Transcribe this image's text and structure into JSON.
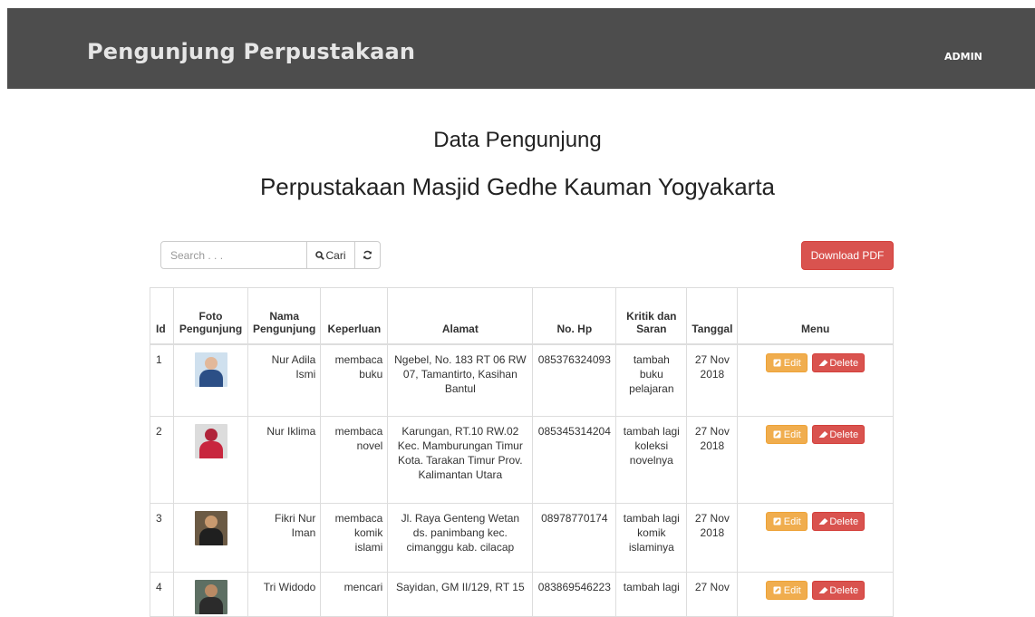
{
  "navbar": {
    "brand": "Pengunjung Perpustakaan",
    "user": "ADMIN"
  },
  "heading": {
    "title": "Data Pengunjung",
    "subtitle": "Perpustakaan Masjid Gedhe Kauman Yogyakarta"
  },
  "toolbar": {
    "search_placeholder": "Search . . .",
    "search_button": "Cari",
    "download_button": "Download PDF"
  },
  "table": {
    "headers": {
      "id": "Id",
      "foto": [
        "Foto",
        "Pengunjung"
      ],
      "nama": [
        "Nama",
        "Pengunjung"
      ],
      "keperluan": "Keperluan",
      "alamat": "Alamat",
      "nohp": "No. Hp",
      "kritik": [
        "Kritik dan",
        "Saran"
      ],
      "tanggal": "Tanggal",
      "menu": "Menu"
    },
    "rows": [
      {
        "id": "1",
        "nama": [
          "Nur Adila",
          "Ismi"
        ],
        "keperluan": [
          "membaca",
          "buku"
        ],
        "alamat": [
          "Ngebel, No. 183 RT 06 RW",
          "07, Tamantirto, Kasihan",
          "Bantul"
        ],
        "nohp": "085376324093",
        "kritik": [
          "tambah",
          "buku",
          "pelajaran"
        ],
        "tanggal": [
          "27 Nov",
          "2018"
        ]
      },
      {
        "id": "2",
        "nama": [
          "Nur Iklima"
        ],
        "keperluan": [
          "membaca",
          "novel"
        ],
        "alamat": [
          "Karungan, RT.10 RW.02",
          "Kec. Mamburungan Timur",
          "Kota. Tarakan Timur Prov.",
          "Kalimantan Utara"
        ],
        "nohp": "085345314204",
        "kritik": [
          "tambah lagi",
          "koleksi",
          "novelnya"
        ],
        "tanggal": [
          "27 Nov",
          "2018"
        ]
      },
      {
        "id": "3",
        "nama": [
          "Fikri Nur",
          "Iman"
        ],
        "keperluan": [
          "membaca",
          "komik",
          "islami"
        ],
        "alamat": [
          "Jl. Raya Genteng Wetan",
          "ds. panimbang kec.",
          "cimanggu kab. cilacap"
        ],
        "nohp": "08978770174",
        "kritik": [
          "tambah lagi",
          "komik",
          "islaminya"
        ],
        "tanggal": [
          "27 Nov",
          "2018"
        ]
      },
      {
        "id": "4",
        "nama": [
          "Tri Widodo"
        ],
        "keperluan": [
          "mencari"
        ],
        "alamat": [
          "Sayidan, GM II/129, RT 15"
        ],
        "nohp": "083869546223",
        "kritik": [
          "tambah lagi"
        ],
        "tanggal": [
          "27 Nov"
        ]
      }
    ],
    "actions": {
      "edit": "Edit",
      "delete": "Delete"
    }
  }
}
